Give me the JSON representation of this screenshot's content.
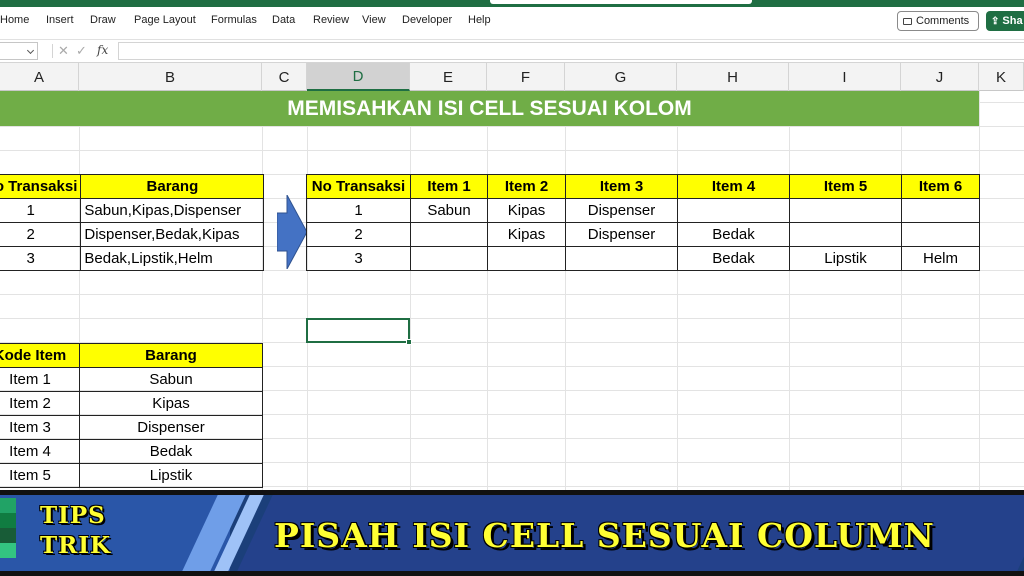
{
  "ribbon": {
    "tabs": [
      "Home",
      "Insert",
      "Draw",
      "Page Layout",
      "Formulas",
      "Data",
      "Review",
      "View",
      "Developer",
      "Help"
    ],
    "comments_label": "Comments",
    "share_label": "Sha"
  },
  "formula_bar": {
    "fx_label": "fx",
    "cancel_glyph": "✕",
    "enter_glyph": "✓"
  },
  "columns": [
    "A",
    "B",
    "C",
    "D",
    "E",
    "F",
    "G",
    "H",
    "I",
    "J",
    "K"
  ],
  "selected_column": "D",
  "sheet": {
    "title": "MEMISAHKAN ISI CELL SESUAI KOLOM",
    "source_table": {
      "headers": [
        "No Transaksi",
        "Barang"
      ],
      "rows": [
        [
          "1",
          "Sabun,Kipas,Dispenser"
        ],
        [
          "2",
          "Dispenser,Bedak,Kipas"
        ],
        [
          "3",
          "Bedak,Lipstik,Helm"
        ]
      ]
    },
    "result_table": {
      "headers": [
        "No Transaksi",
        "Item 1",
        "Item 2",
        "Item 3",
        "Item 4",
        "Item 5",
        "Item 6"
      ],
      "rows": [
        [
          "1",
          "Sabun",
          "Kipas",
          "Dispenser",
          "",
          "",
          ""
        ],
        [
          "2",
          "",
          "Kipas",
          "Dispenser",
          "Bedak",
          "",
          ""
        ],
        [
          "3",
          "",
          "",
          "",
          "Bedak",
          "Lipstik",
          "Helm"
        ]
      ]
    },
    "code_table": {
      "headers": [
        "Kode Item",
        "Barang"
      ],
      "rows": [
        [
          "Item 1",
          "Sabun"
        ],
        [
          "Item 2",
          "Kipas"
        ],
        [
          "Item 3",
          "Dispenser"
        ],
        [
          "Item 4",
          "Bedak"
        ],
        [
          "Item 5",
          "Lipstik"
        ]
      ]
    }
  },
  "banner": {
    "tag_line1": "TIPS",
    "tag_line2": "TRIK",
    "headline": "PISAH ISI CELL SESUAI COLUMN"
  },
  "colors": {
    "excel_green": "#1f6e43",
    "title_green": "#70ad47",
    "header_yellow": "#ffff00",
    "arrow_blue": "#4472c4",
    "banner_navy": "#24418b",
    "banner_text": "#ffff33"
  }
}
